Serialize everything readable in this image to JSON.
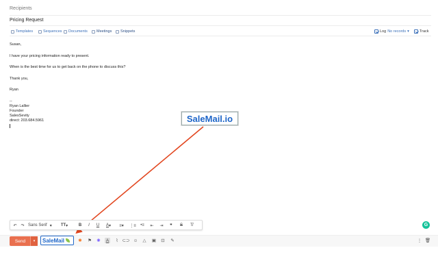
{
  "compose": {
    "recipients_label": "Recipients",
    "subject": "Pricing Request"
  },
  "extension_bar": {
    "items": [
      {
        "label": "Templates",
        "icon": "template-icon"
      },
      {
        "label": "Sequences",
        "icon": "sequence-icon"
      },
      {
        "label": "Documents",
        "icon": "document-icon"
      },
      {
        "label": "Meetings",
        "icon": "calendar-icon"
      },
      {
        "label": "Snippets",
        "icon": "snippet-icon"
      }
    ],
    "log_label": "Log",
    "log_value": "No records",
    "track_label": "Track"
  },
  "body": {
    "lines": [
      "Susan,",
      "I have your pricing information ready to present.",
      "When is the best time for us to get back on the phone to discuss this?",
      "Thank you,",
      "Ryan"
    ],
    "signature": [
      "--",
      "Ryan Lallier",
      "Founder",
      "SalesSevity",
      "direct: 203.684.5961"
    ]
  },
  "callout": {
    "label": "SaleMail.io"
  },
  "format_toolbar": {
    "font": "Sans Serif"
  },
  "action_bar": {
    "send_label": "Send",
    "salemail_label": "SaleMail"
  },
  "colors": {
    "accent_blue": "#1e66c8",
    "send_orange": "#e9704f",
    "arrow_red": "#e2461f",
    "grammarly_green": "#15c39a"
  }
}
